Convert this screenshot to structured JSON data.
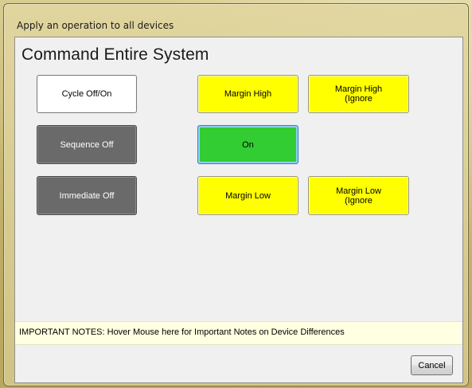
{
  "window": {
    "title": "Apply an operation to all devices",
    "heading": "Command Entire System"
  },
  "buttons": {
    "cycle_off_on": "Cycle Off/On",
    "sequence_off": "Sequence Off",
    "immediate_off": "Immediate Off",
    "margin_high": "Margin High",
    "margin_high_ignore": "Margin High (Ignore",
    "on": "On",
    "margin_low": "Margin Low",
    "margin_low_ignore": "Margin Low (Ignore"
  },
  "notes": {
    "text": "IMPORTANT NOTES: Hover Mouse here for Important Notes on Device Differences"
  },
  "footer": {
    "cancel_label": "Cancel"
  },
  "colors": {
    "yellow": "#ffff00",
    "green": "#32cd32",
    "dark_gray": "#6a6a6a",
    "notes_background": "#ffffe1"
  }
}
